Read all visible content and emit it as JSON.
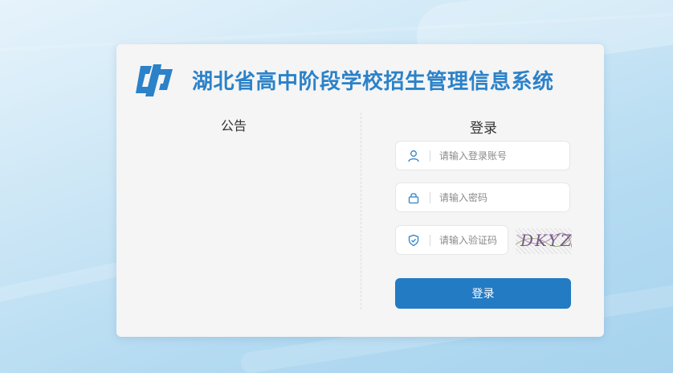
{
  "header": {
    "title": "湖北省高中阶段学校招生管理信息系统"
  },
  "notice": {
    "title": "公告"
  },
  "login": {
    "title": "登录",
    "account_placeholder": "请输入登录账号",
    "password_placeholder": "请输入密码",
    "captcha_placeholder": "请输入验证码",
    "captcha_text": "DKYZ",
    "submit_label": "登录"
  },
  "colors": {
    "brand": "#2b82c9",
    "button": "#237bc4"
  },
  "icons": [
    "logo-icon",
    "user-icon",
    "lock-icon",
    "shield-icon"
  ]
}
